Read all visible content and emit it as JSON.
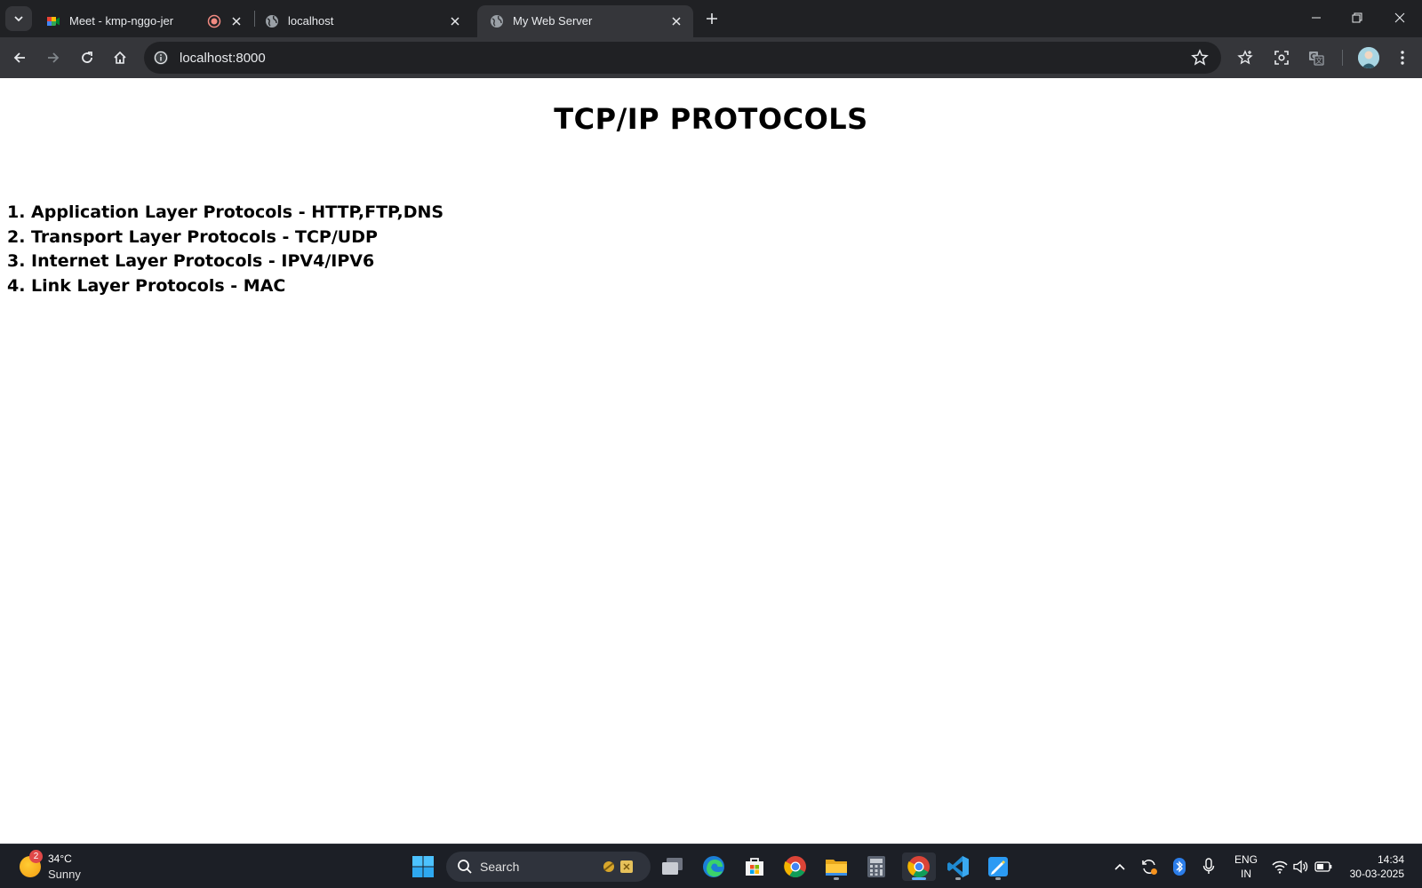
{
  "browser": {
    "tabs": [
      {
        "title": "Meet - kmp-nggo-jer",
        "icon": "google-meet-icon",
        "recording": true,
        "active": false
      },
      {
        "title": "localhost",
        "icon": "globe-icon",
        "active": false
      },
      {
        "title": "My Web Server",
        "icon": "globe-icon",
        "active": true
      }
    ],
    "address_bar": {
      "url": "localhost:8000"
    }
  },
  "page": {
    "heading": "TCP/IP PROTOCOLS",
    "items": [
      "1. Application Layer Protocols - HTTP,FTP,DNS",
      "2. Transport Layer Protocols - TCP/UDP",
      "3. Internet Layer Protocols - IPV4/IPV6",
      "4. Link Layer Protocols - MAC"
    ]
  },
  "taskbar": {
    "weather": {
      "temp": "34°C",
      "condition": "Sunny",
      "badge": "2"
    },
    "search_placeholder": "Search",
    "pinned_apps": [
      "windows-start-icon",
      "task-view-icon",
      "edge-icon",
      "store-icon",
      "chrome-icon",
      "file-explorer-icon",
      "calculator-icon",
      "chrome-icon",
      "vscode-icon",
      "paint-icon"
    ],
    "language": {
      "line1": "ENG",
      "line2": "IN"
    },
    "clock": {
      "time": "14:34",
      "date": "30-03-2025"
    }
  },
  "colors": {
    "tabstrip_bg": "#202124",
    "toolbar_bg": "#35363a",
    "taskbar_bg": "#1c1f26",
    "page_bg": "#ffffff"
  }
}
